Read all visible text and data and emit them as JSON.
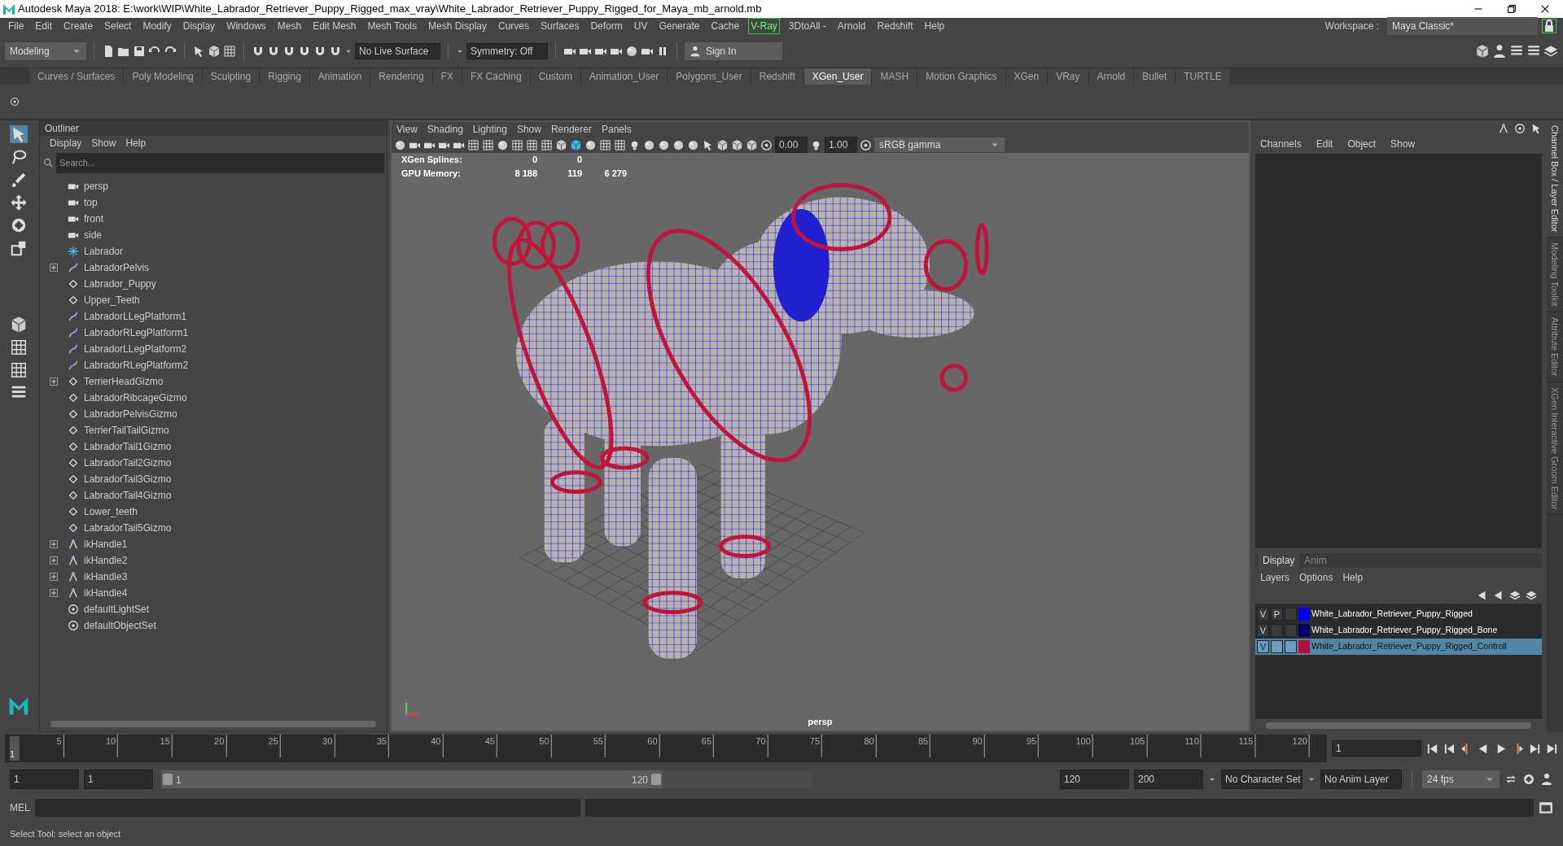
{
  "window": {
    "title": "Autodesk Maya 2018: E:\\work\\WIP\\White_Labrador_Retriever_Puppy_Rigged_max_vray\\White_Labrador_Retriever_Puppy_Rigged_for_Maya_mb_arnold.mb"
  },
  "menu_bar": [
    {
      "label": "File",
      "kind": "plain"
    },
    {
      "label": "Edit",
      "kind": "plain"
    },
    {
      "label": "Create",
      "kind": "plain"
    },
    {
      "label": "Select",
      "kind": "plain"
    },
    {
      "label": "Modify",
      "kind": "plain"
    },
    {
      "label": "Display",
      "kind": "plain"
    },
    {
      "label": "Windows",
      "kind": "plain"
    },
    {
      "label": "Mesh",
      "kind": "plain"
    },
    {
      "label": "Edit Mesh",
      "kind": "plain"
    },
    {
      "label": "Mesh Tools",
      "kind": "plain"
    },
    {
      "label": "Mesh Display",
      "kind": "plain"
    },
    {
      "label": "Curves",
      "kind": "plain"
    },
    {
      "label": "Surfaces",
      "kind": "plain"
    },
    {
      "label": "Deform",
      "kind": "plain"
    },
    {
      "label": "UV",
      "kind": "plain"
    },
    {
      "label": "Generate",
      "kind": "plain"
    },
    {
      "label": "Cache",
      "kind": "plain"
    },
    {
      "label": "V-Ray",
      "kind": "tag"
    },
    {
      "label": "3DtoAll -",
      "kind": "plain"
    },
    {
      "label": "Arnold",
      "kind": "plain"
    },
    {
      "label": "Redshift",
      "kind": "plain"
    },
    {
      "label": "Help",
      "kind": "plain"
    }
  ],
  "workspace": {
    "label": "Workspace :",
    "value": "Maya Classic*"
  },
  "status_line": {
    "mode": "Modeling",
    "live_surface": "No Live Surface",
    "symmetry": "Symmetry: Off",
    "sign_in": "Sign In"
  },
  "shelf_tabs": [
    {
      "label": "Curves / Surfaces",
      "selected": false
    },
    {
      "label": "Poly Modeling",
      "selected": false
    },
    {
      "label": "Sculpting",
      "selected": false
    },
    {
      "label": "Rigging",
      "selected": false
    },
    {
      "label": "Animation",
      "selected": false
    },
    {
      "label": "Rendering",
      "selected": false
    },
    {
      "label": "FX",
      "selected": false
    },
    {
      "label": "FX Caching",
      "selected": false
    },
    {
      "label": "Custom",
      "selected": false
    },
    {
      "label": "Animation_User",
      "selected": false
    },
    {
      "label": "Polygons_User",
      "selected": false
    },
    {
      "label": "Redshift",
      "selected": false
    },
    {
      "label": "XGen_User",
      "selected": true
    },
    {
      "label": "MASH",
      "selected": false
    },
    {
      "label": "Motion Graphics",
      "selected": false
    },
    {
      "label": "XGen",
      "selected": false
    },
    {
      "label": "VRay",
      "selected": false
    },
    {
      "label": "Arnold",
      "selected": false
    },
    {
      "label": "Bullet",
      "selected": false
    },
    {
      "label": "TURTLE",
      "selected": false
    }
  ],
  "outliner": {
    "title": "Outliner",
    "menus": [
      "Display",
      "Show",
      "Help"
    ],
    "placeholder": "Search...",
    "items": [
      {
        "label": "persp",
        "kind": "camera",
        "expandable": false
      },
      {
        "label": "top",
        "kind": "camera",
        "expandable": false
      },
      {
        "label": "front",
        "kind": "camera",
        "expandable": false
      },
      {
        "label": "side",
        "kind": "camera",
        "expandable": false
      },
      {
        "label": "Labrador",
        "kind": "joint",
        "expandable": false
      },
      {
        "label": "LabradorPelvis",
        "kind": "curve",
        "expandable": true
      },
      {
        "label": "Labrador_Puppy",
        "kind": "transform",
        "expandable": false
      },
      {
        "label": "Upper_Teeth",
        "kind": "transform",
        "expandable": false
      },
      {
        "label": "LabradorLLegPlatform1",
        "kind": "curve",
        "expandable": false
      },
      {
        "label": "LabradorRLegPlatform1",
        "kind": "curve",
        "expandable": false
      },
      {
        "label": "LabradorLLegPlatform2",
        "kind": "curve",
        "expandable": false
      },
      {
        "label": "LabradorRLegPlatform2",
        "kind": "curve",
        "expandable": false
      },
      {
        "label": "TerrierHeadGizmo",
        "kind": "transform",
        "expandable": true
      },
      {
        "label": "LabradorRibcageGizmo",
        "kind": "transform",
        "expandable": false
      },
      {
        "label": "LabradorPelvisGizmo",
        "kind": "transform",
        "expandable": false
      },
      {
        "label": "TerrierTailTailGizmo",
        "kind": "transform",
        "expandable": false
      },
      {
        "label": "LabradorTail1Gizmo",
        "kind": "transform",
        "expandable": false
      },
      {
        "label": "LabradorTail2Gizmo",
        "kind": "transform",
        "expandable": false
      },
      {
        "label": "LabradorTail3Gizmo",
        "kind": "transform",
        "expandable": false
      },
      {
        "label": "LabradorTail4Gizmo",
        "kind": "transform",
        "expandable": false
      },
      {
        "label": "Lower_teeth",
        "kind": "transform",
        "expandable": false
      },
      {
        "label": "LabradorTail5Gizmo",
        "kind": "transform",
        "expandable": false
      },
      {
        "label": "ikHandle1",
        "kind": "ik",
        "expandable": true
      },
      {
        "label": "ikHandle2",
        "kind": "ik",
        "expandable": true
      },
      {
        "label": "ikHandle3",
        "kind": "ik",
        "expandable": true
      },
      {
        "label": "ikHandle4",
        "kind": "ik",
        "expandable": true
      },
      {
        "label": "defaultLightSet",
        "kind": "set",
        "expandable": false
      },
      {
        "label": "defaultObjectSet",
        "kind": "set",
        "expandable": false
      }
    ]
  },
  "viewport": {
    "menus": [
      "View",
      "Shading",
      "Lighting",
      "Show",
      "Renderer",
      "Panels"
    ],
    "exposure": "0.00",
    "gamma": "1.00",
    "color_space": "sRGB gamma",
    "hud": [
      {
        "label": "XGen Splines:",
        "values": [
          "0",
          "0"
        ]
      },
      {
        "label": "GPU Memory:",
        "values": [
          "8 188",
          "119",
          "6 279"
        ]
      }
    ],
    "camera_label": "persp"
  },
  "channel_box": {
    "menus": [
      "Channels",
      "Edit",
      "Object",
      "Show"
    ]
  },
  "layer_editor": {
    "tabs": [
      {
        "label": "Display",
        "selected": true
      },
      {
        "label": "Anim",
        "selected": false
      }
    ],
    "menus": [
      "Layers",
      "Options",
      "Help"
    ],
    "layers": [
      {
        "visible": "V",
        "playback": "P",
        "color": "#0000ff",
        "name": "White_Labrador_Retriever_Puppy_Rigged",
        "selected": false
      },
      {
        "visible": "V",
        "color": "#000066",
        "name": "White_Labrador_Retriever_Puppy_Rigged_Bone",
        "selected": false
      },
      {
        "visible": "V",
        "color": "#b0103a",
        "name": "White_Labrador_Retriever_Puppy_Rigged_Controll",
        "selected": true
      }
    ]
  },
  "side_tabs": [
    {
      "label": "Channel Box / Layer Editor",
      "selected": true
    },
    {
      "label": "Modeling Toolkit",
      "selected": false
    },
    {
      "label": "Attribute Editor",
      "selected": false
    },
    {
      "label": "XGen Interactive Groom Editor",
      "selected": false
    }
  ],
  "time_slider": {
    "current": "1",
    "level": 0,
    "ticks": [
      "5",
      "10",
      "15",
      "20",
      "25",
      "30",
      "35",
      "40",
      "45",
      "50",
      "55",
      "60",
      "65",
      "70",
      "75",
      "80",
      "85",
      "90",
      "95",
      "100",
      "105",
      "110",
      "115",
      "120"
    ],
    "frame_field": "1"
  },
  "range_slider": {
    "level": 0.77,
    "start": "1",
    "playback_start": "1",
    "slider_start": "1",
    "slider_end": "120",
    "playback_end": "120",
    "end": "200",
    "character_set": "No Character Set",
    "anim_layer": "No Anim Layer",
    "fps": "24 fps"
  },
  "command_line": {
    "label": "MEL"
  },
  "help_line": "Select Tool: select an object"
}
